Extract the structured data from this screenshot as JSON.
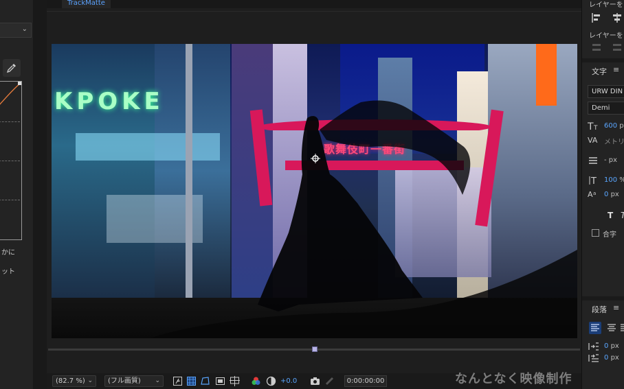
{
  "viewer": {
    "tab_label": "TrackMatte",
    "zoom": "(82.7 %)",
    "resolution": "(フル画質)",
    "exposure": "+0.0",
    "timecode": "0:00:00:00",
    "canvas_signs": {
      "kpoke": "KPOKE",
      "arch": "歌舞伎町一番街"
    }
  },
  "left_panel": {
    "button1": "かに",
    "button2": "ット"
  },
  "right_panel": {
    "layer_align_1": "レイヤーを",
    "layer_align_2": "レイヤーを",
    "text_heading": "文字",
    "font_family": "URW DIN C",
    "font_style": "Demi",
    "font_size_value": "600",
    "font_size_unit": "px",
    "kerning_label": "メトリ",
    "leading_value": "- px",
    "vert_scale_value": "100",
    "vert_scale_unit": "%",
    "baseline_value": "0",
    "baseline_unit": "px",
    "ligature_label": "合字",
    "paragraph_heading": "段落",
    "indent_left_value": "0",
    "indent_left_unit": "px",
    "indent_first_value": "0",
    "indent_first_unit": "px",
    "menu_icon": "≡"
  },
  "watermark": "なんとなく映像制作",
  "colors": {
    "accent_blue": "#5aa6ff",
    "panel_bg": "#232323",
    "active_button": "#1b3e78"
  }
}
